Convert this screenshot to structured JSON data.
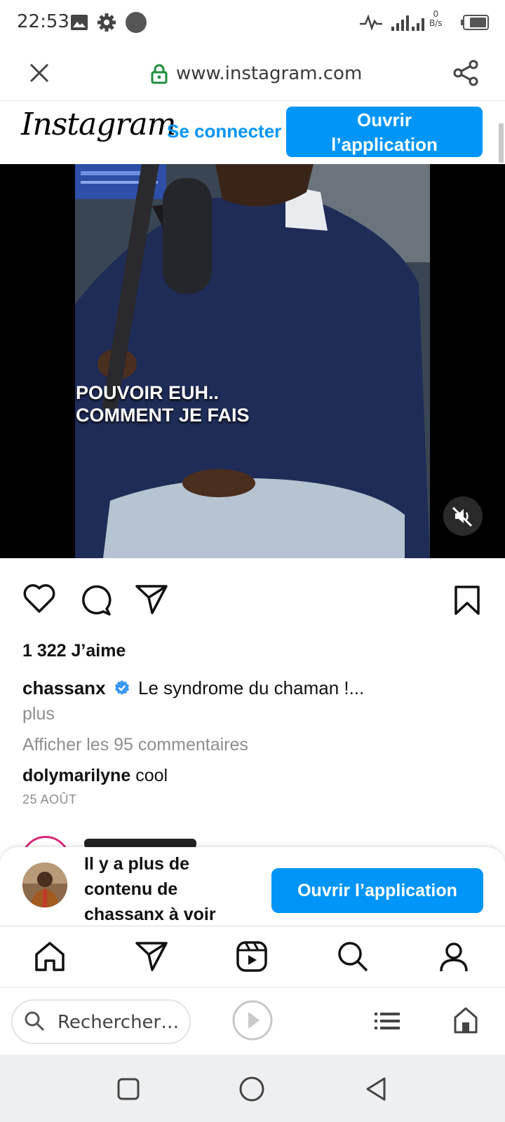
{
  "status_bar": {
    "time": "22:53",
    "net_speed_value": "0",
    "net_speed_unit": "B/s",
    "icons": [
      "gallery-icon",
      "settings-icon",
      "dot-icon",
      "activity-icon",
      "signal-icon",
      "battery-icon"
    ]
  },
  "browser": {
    "url": "www.instagram.com",
    "close_icon": "close-icon",
    "lock_icon": "lock-icon",
    "share_icon": "share-icon"
  },
  "header": {
    "logo": "Instagram",
    "login_label": "Se connecter",
    "open_app_label": "Ouvrir l’application"
  },
  "video": {
    "caption_line1": "POUVOIR EUH..",
    "caption_line2": "COMMENT JE FAIS",
    "mute_icon": "muted-speaker-icon"
  },
  "post": {
    "likes": "1 322 J’aime",
    "username": "chassanx",
    "verified_icon": "verified-badge-icon",
    "caption": "Le syndrome du chaman !...",
    "more_label": "plus",
    "view_comments": "Afficher les 95 commentaires",
    "comment_user": "dolymarilyne",
    "comment_text": "cool",
    "date": "25 AOÛT",
    "actions": [
      "heart-icon",
      "comment-icon",
      "send-icon",
      "bookmark-icon"
    ]
  },
  "banner": {
    "text": "Il y a plus de contenu de chassanx à voir",
    "button_label": "Ouvrir l’application"
  },
  "ig_nav": [
    "home-icon",
    "send-icon",
    "reels-icon",
    "search-icon",
    "profile-icon"
  ],
  "browser_bottom": {
    "search_placeholder": "Rechercher…",
    "icons": [
      "search-icon",
      "play-icon",
      "menu-list-icon",
      "home-icon"
    ]
  },
  "colors": {
    "accent": "#0095f6",
    "text": "#111111",
    "muted": "#8e8e8e"
  }
}
